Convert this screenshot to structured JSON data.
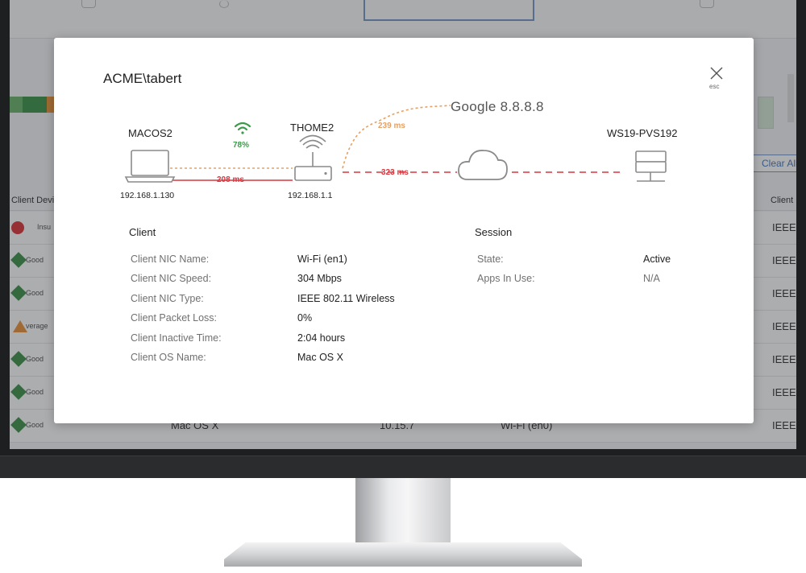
{
  "background": {
    "clear_all": "Clear All F",
    "col_client_device": "Client Devic",
    "col_client": "Client",
    "rows": [
      {
        "status": "red-circle",
        "status_text": "Insu",
        "ieee": "IEEE"
      },
      {
        "status": "green-diamond",
        "status_text": "Good",
        "ieee": "IEEE"
      },
      {
        "status": "green-diamond",
        "status_text": "Good",
        "ieee": "IEEE"
      },
      {
        "status": "orange-triangle",
        "status_text": "verage",
        "ieee": "IEEE"
      },
      {
        "status": "green-diamond",
        "status_text": "Good",
        "ieee": "IEEE"
      },
      {
        "status": "green-diamond",
        "status_text": "Good",
        "ieee": "IEEE"
      },
      {
        "status": "green-diamond",
        "status_text": "Good",
        "ieee": "IEEE",
        "os": "Mac OS X",
        "version": "10.15.7",
        "nic": "Wi-Fi (en0)"
      }
    ]
  },
  "modal": {
    "title": "ACME\\tabert",
    "close_label": "esc",
    "diagram": {
      "client_name": "MACOS2",
      "client_ip": "192.168.1.130",
      "wifi_signal": "78%",
      "router_name": "THOME2",
      "router_ip": "192.168.1.1",
      "latency_client_router": "208 ms",
      "latency_router_google": "239 ms",
      "latency_router_server": "323 ms",
      "google_label": "Google  8.8.8.8",
      "server_name": "WS19-PVS192"
    },
    "client": {
      "title": "Client",
      "rows": [
        {
          "label": "Client NIC Name:",
          "value": "Wi-Fi (en1)"
        },
        {
          "label": "Client NIC Speed:",
          "value": "304 Mbps"
        },
        {
          "label": "Client NIC Type:",
          "value": "IEEE 802.11 Wireless"
        },
        {
          "label": "Client Packet Loss:",
          "value": "0%"
        },
        {
          "label": "Client Inactive Time:",
          "value": "2:04 hours"
        },
        {
          "label": "Client OS Name:",
          "value": "Mac OS X"
        }
      ]
    },
    "session": {
      "title": "Session",
      "rows": [
        {
          "label": "State:",
          "value": "Active"
        },
        {
          "label": "Apps In Use:",
          "value": "N/A"
        }
      ]
    }
  },
  "colors": {
    "latency_red": "#d9363e",
    "latency_orange": "#e8a060",
    "wifi_green": "#3c9a4a",
    "icon_gray": "#8a8a8a"
  }
}
